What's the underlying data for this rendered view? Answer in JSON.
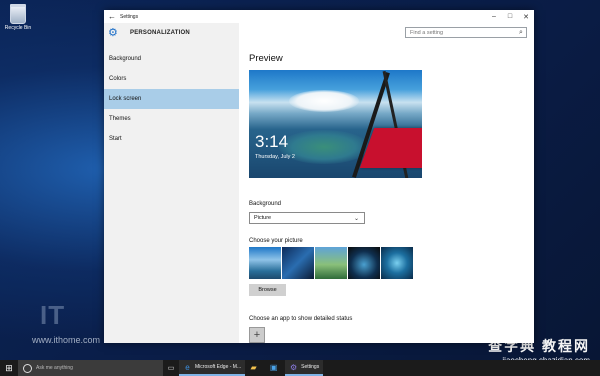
{
  "desktop": {
    "recycle_bin_label": "Recycle Bin",
    "watermark_logo": "IT",
    "watermark_url": "www.ithome.com",
    "watermark_right_title": "查字典 教程网",
    "watermark_right_url": "jiaocheng.chazidian.com"
  },
  "window": {
    "title": "Settings",
    "back_icon": "back-arrow-icon",
    "minimize_icon": "minimize-icon",
    "maximize_icon": "maximize-icon",
    "close_icon": "close-icon"
  },
  "header": {
    "icon": "gear-icon",
    "title": "PERSONALIZATION"
  },
  "search": {
    "placeholder": "Find a setting",
    "value": "",
    "icon": "search-icon"
  },
  "nav": {
    "items": [
      {
        "label": "Background",
        "active": false
      },
      {
        "label": "Colors",
        "active": false
      },
      {
        "label": "Lock screen",
        "active": true
      },
      {
        "label": "Themes",
        "active": false
      },
      {
        "label": "Start",
        "active": false
      }
    ]
  },
  "main": {
    "preview_heading": "Preview",
    "preview_time": "3:14",
    "preview_date": "Thursday, July 2",
    "background_label": "Background",
    "background_value": "Picture",
    "choose_picture_label": "Choose your picture",
    "browse_label": "Browse",
    "detailed_status_label": "Choose an app to show detailed status",
    "add_app_label": "+"
  },
  "taskbar": {
    "start_icon": "windows-logo-icon",
    "search_placeholder": "Ask me anything",
    "task_view_icon": "task-view-icon",
    "apps": [
      {
        "label": "Microsoft Edge - M...",
        "icon": "edge-icon",
        "open": true
      },
      {
        "label": "",
        "icon": "file-explorer-icon",
        "open": false
      },
      {
        "label": "",
        "icon": "store-icon",
        "open": false
      },
      {
        "label": "Settings",
        "icon": "settings-icon",
        "open": true
      }
    ]
  },
  "colors": {
    "accent": "#1a6dc7",
    "nav_active": "#a9cde8",
    "taskbar": "#1b1b1b"
  }
}
